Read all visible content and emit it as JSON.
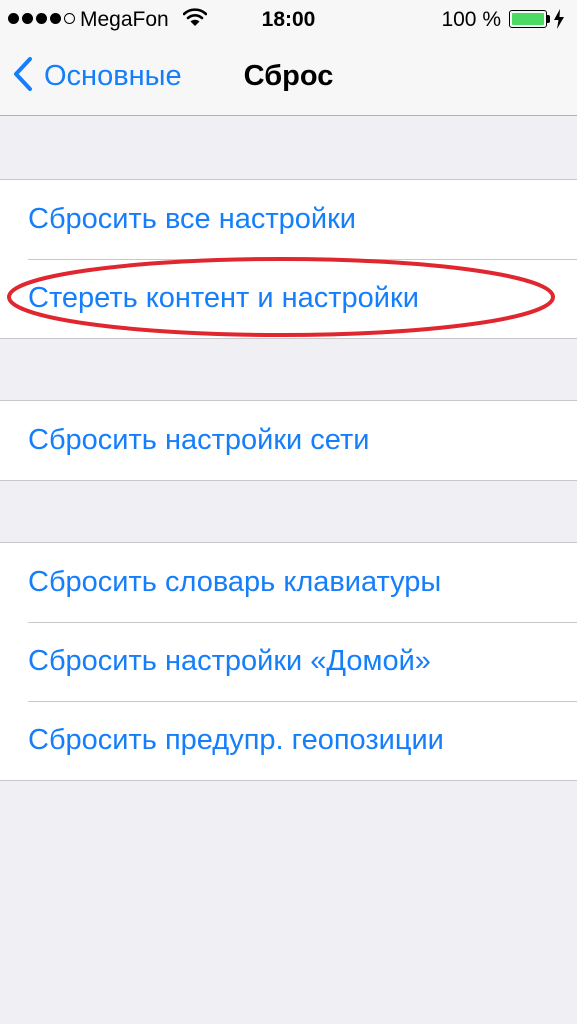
{
  "status_bar": {
    "carrier": "MegaFon",
    "time": "18:00",
    "battery_percent": "100 %",
    "signal_bars_filled": 4,
    "signal_bars_total": 5,
    "battery_level": 1.0,
    "battery_color": "#4cd964",
    "wifi_icon": "wifi-icon",
    "charging_icon": "bolt-icon"
  },
  "nav": {
    "back_label": "Основные",
    "title": "Сброс",
    "accent_color": "#157efb"
  },
  "groups": [
    {
      "rows": [
        {
          "label": "Сбросить все настройки"
        },
        {
          "label": "Стереть контент и настройки"
        }
      ]
    },
    {
      "rows": [
        {
          "label": "Сбросить настройки сети"
        }
      ]
    },
    {
      "rows": [
        {
          "label": "Сбросить словарь клавиатуры"
        },
        {
          "label": "Сбросить настройки «Домой»"
        },
        {
          "label": "Сбросить предупр. геопозиции"
        }
      ]
    }
  ],
  "annotation": {
    "color": "#e0262e"
  }
}
